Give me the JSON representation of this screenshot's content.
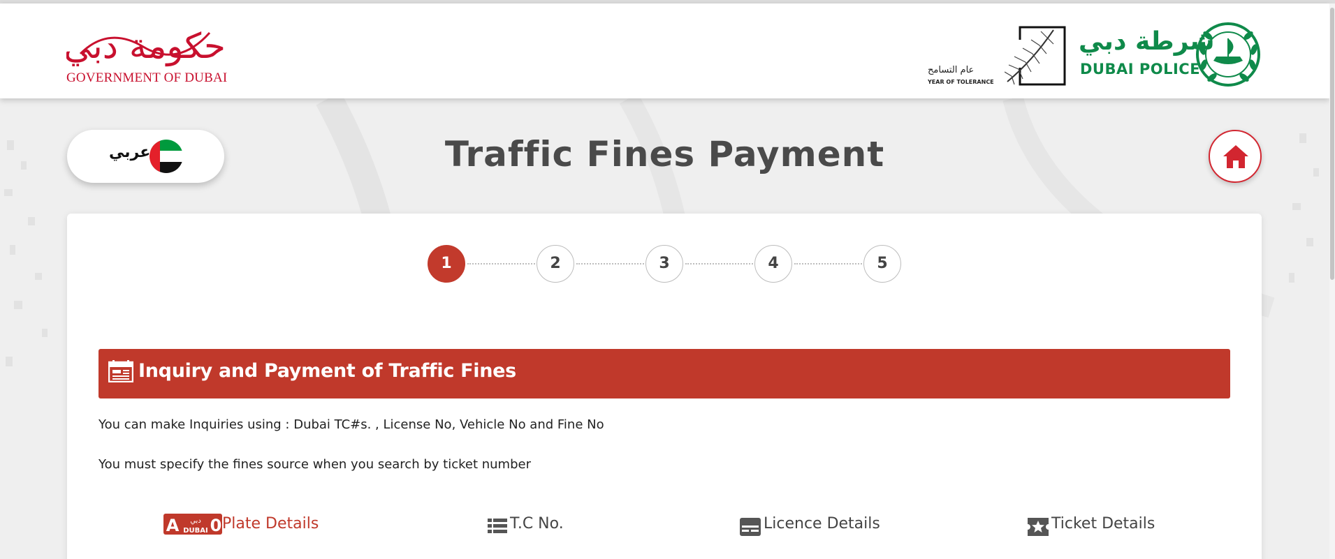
{
  "header": {
    "gov_logo_arabic": "حكومة دبي",
    "gov_logo_text": "GOVERNMENT OF DUBAI",
    "tolerance_arabic": "عام التسامح",
    "tolerance_english": "YEAR OF TOLERANCE",
    "police_arabic": "شرطة دبي",
    "police_english": "DUBAI POLICE"
  },
  "language_toggle": {
    "label": "عربي"
  },
  "page": {
    "title": "Traffic Fines Payment"
  },
  "steps": [
    "1",
    "2",
    "3",
    "4",
    "5"
  ],
  "active_step": "1",
  "section": {
    "title": "Inquiry and Payment of Traffic Fines",
    "info_1": "You can make Inquiries using : Dubai TC#s. , License No, Vehicle No and Fine No",
    "info_2": "You must specify the fines source when you search by ticket number"
  },
  "tabs": {
    "plate": {
      "label": "Plate Details",
      "icon_text_letter": "A",
      "icon_text_city": "DUBAI",
      "icon_text_digit": "0",
      "icon_text_arabic": "دبي"
    },
    "tc": {
      "label": "T.C No."
    },
    "licence": {
      "label": "Licence Details"
    },
    "ticket": {
      "label": "Ticket Details"
    }
  },
  "colors": {
    "primary_red": "#c0392b",
    "gov_red": "#c8102e",
    "police_green": "#0f8a4a"
  },
  "icons": [
    "home-icon",
    "uae-flag-icon",
    "calendar-icon",
    "plate-icon",
    "list-icon",
    "licence-card-icon",
    "ticket-star-icon",
    "palm-frond-icon",
    "police-emblem-icon"
  ]
}
